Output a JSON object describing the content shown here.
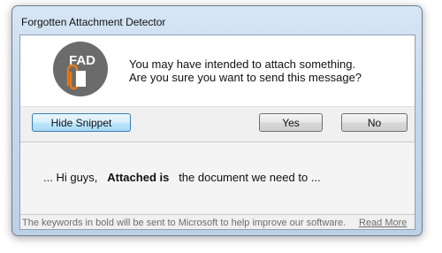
{
  "window": {
    "title": "Forgotten Attachment Detector"
  },
  "logo": {
    "text": "FAD",
    "icon": "paperclip-icon",
    "circle_color": "#6b6b6b",
    "clip_color": "#e07a1f"
  },
  "message": {
    "line1": "You may have intended to attach something.",
    "line2": "Are you sure you want to send this message?"
  },
  "buttons": {
    "hide_snippet": "Hide Snippet",
    "yes": "Yes",
    "no": "No"
  },
  "snippet": {
    "prefix": "... Hi guys,",
    "keyword": "Attached is",
    "suffix": "the document we need to ..."
  },
  "footer": {
    "note": "The keywords in bold will be sent to Microsoft to help improve our software.",
    "read_more": "Read More"
  }
}
